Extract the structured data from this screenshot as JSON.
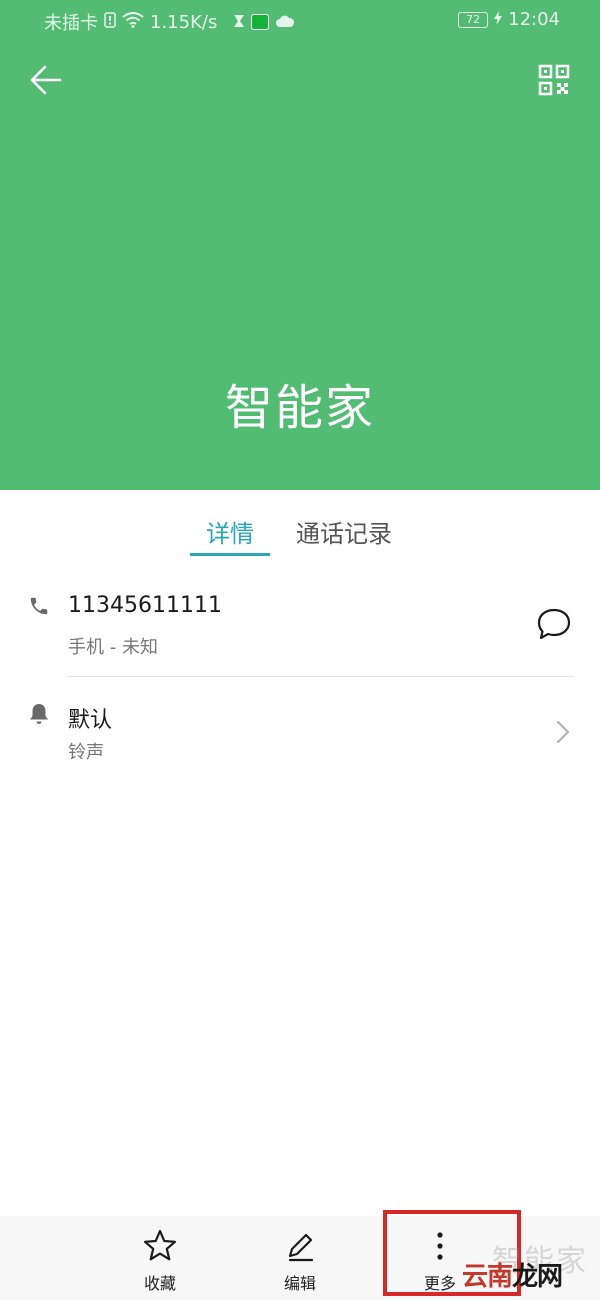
{
  "status_bar": {
    "carrier": "未插卡",
    "net_speed": "1.15K/s",
    "battery": "72",
    "time": "12:04"
  },
  "header": {
    "contact_name": "智能家",
    "back_icon": "arrow-left-icon",
    "qr_icon": "qr-code-icon",
    "background_color": "#52bd72"
  },
  "tabs": [
    {
      "label": "详情",
      "active": true
    },
    {
      "label": "通话记录",
      "active": false
    }
  ],
  "details": {
    "phone": {
      "number": "11345611111",
      "type": "手机 - 未知",
      "icon": "phone-icon",
      "action_icon": "message-icon"
    },
    "ringtone": {
      "value": "默认",
      "label": "铃声",
      "icon": "bell-icon"
    }
  },
  "bottom_bar": {
    "favorite": "收藏",
    "edit": "编辑",
    "more": "更多"
  },
  "watermark": {
    "top": "智能家",
    "main_prefix": "云南",
    "main_mid": "龙",
    "main_suffix": "网"
  },
  "accent_color": "#2aa6b4",
  "highlight_color": "#d62828"
}
